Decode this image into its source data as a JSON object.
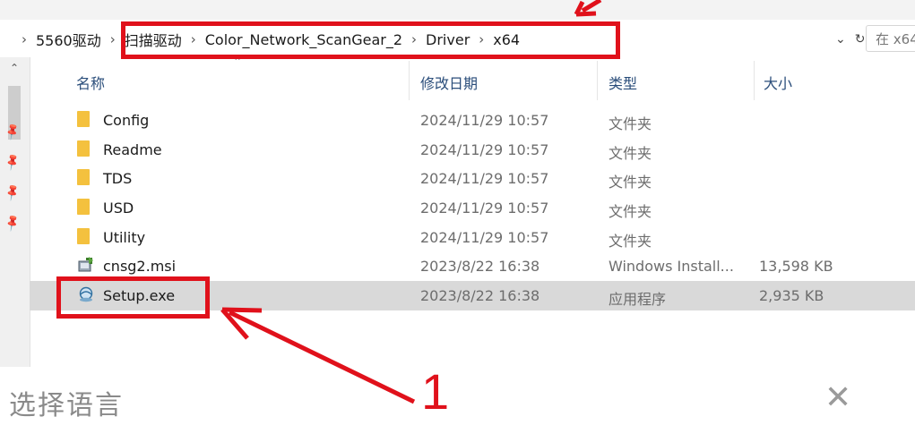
{
  "address_bar": {
    "crumbs": [
      "5560驱动",
      "扫描驱动",
      "Color_Network_ScanGear_2",
      "Driver",
      "x64"
    ],
    "refresh_glyph": "↻",
    "dropdown_glyph": "⌄"
  },
  "search": {
    "placeholder": "在 x64"
  },
  "columns": {
    "name": "名称",
    "date": "修改日期",
    "type": "类型",
    "size": "大小"
  },
  "files": [
    {
      "name": "Config",
      "date": "2024/11/29 10:57",
      "type": "文件夹",
      "size": "",
      "icon": "folder-icon"
    },
    {
      "name": "Readme",
      "date": "2024/11/29 10:57",
      "type": "文件夹",
      "size": "",
      "icon": "folder-icon"
    },
    {
      "name": "TDS",
      "date": "2024/11/29 10:57",
      "type": "文件夹",
      "size": "",
      "icon": "folder-icon"
    },
    {
      "name": "USD",
      "date": "2024/11/29 10:57",
      "type": "文件夹",
      "size": "",
      "icon": "folder-icon"
    },
    {
      "name": "Utility",
      "date": "2024/11/29 10:57",
      "type": "文件夹",
      "size": "",
      "icon": "folder-icon"
    },
    {
      "name": "cnsg2.msi",
      "date": "2023/8/22 16:38",
      "type": "Windows Install...",
      "size": "13,598 KB",
      "icon": "msi-installer-icon"
    },
    {
      "name": "Setup.exe",
      "date": "2023/8/22 16:38",
      "type": "应用程序",
      "size": "2,935 KB",
      "icon": "setup-exe-icon",
      "selected": true
    }
  ],
  "dialog": {
    "title": "选择语言",
    "close_glyph": "✕"
  },
  "annotation": {
    "step_label": "1",
    "color": "#e0111b"
  },
  "colors": {
    "selection": "#d9d9d9",
    "folder": "#f4c13e",
    "header_text": "#2a4d7a"
  }
}
